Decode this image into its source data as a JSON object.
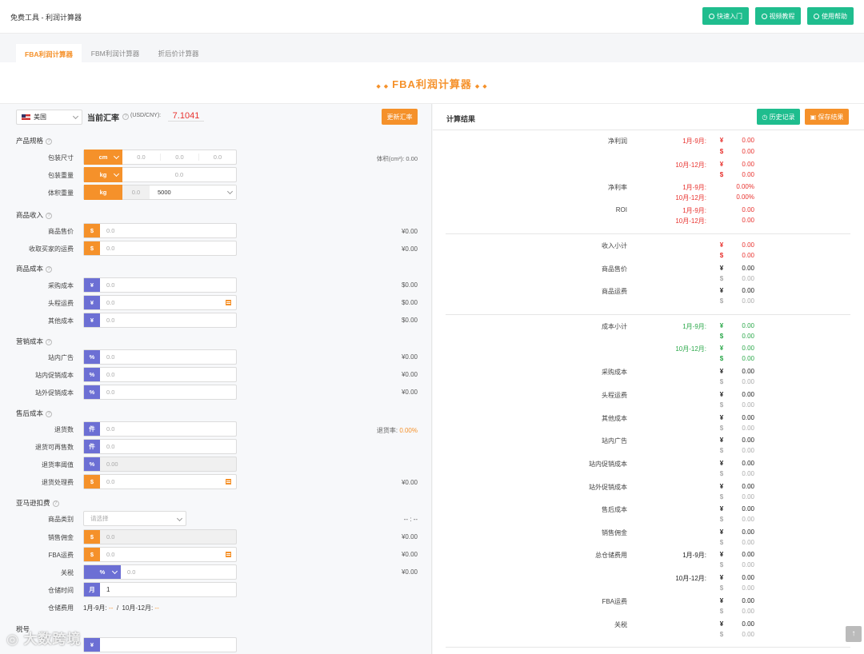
{
  "header": {
    "breadcrumb": "免费工具 - 利润计算器",
    "btn_quick": "快速入门",
    "btn_video": "视频教程",
    "btn_help": "使用帮助"
  },
  "tabs": [
    "FBA利润计算器",
    "FBM利润计算器",
    "折后价计算器"
  ],
  "banner": {
    "title": "FBA利润计算器"
  },
  "rate": {
    "country": "美国",
    "label": "当前汇率",
    "unit": "(USD/CNY):",
    "value": "7.1041",
    "update_btn": "更新汇率"
  },
  "spec": {
    "title": "产品规格",
    "size_label": "包装尺寸",
    "size_unit": "cm",
    "size_ph": [
      "0.0",
      "0.0",
      "0.0"
    ],
    "volume_text": "体积(cm³): 0.00",
    "weight_label": "包装重量",
    "weight_unit": "kg",
    "weight_ph": "0.0",
    "vol_weight_label": "体积重量",
    "vol_weight_unit": "kg",
    "vol_weight_val": "0.0",
    "divisor": "5000"
  },
  "income": {
    "title": "商品收入",
    "rows": [
      {
        "label": "商品售价",
        "pre": "$",
        "ph": "0.0",
        "val": "¥0.00"
      },
      {
        "label": "收取买家的运费",
        "pre": "$",
        "ph": "0.0",
        "val": "¥0.00"
      }
    ]
  },
  "cost": {
    "title": "商品成本",
    "rows": [
      {
        "label": "采购成本",
        "pre": "¥",
        "ph": "0.0",
        "val": "$0.00"
      },
      {
        "label": "头程运费",
        "pre": "¥",
        "ph": "0.0",
        "val": "$0.00"
      },
      {
        "label": "其他成本",
        "pre": "¥",
        "ph": "0.0",
        "val": "$0.00"
      }
    ]
  },
  "marketing": {
    "title": "营销成本",
    "rows": [
      {
        "label": "站内广告",
        "pre": "%",
        "ph": "0.0",
        "val": "¥0.00"
      },
      {
        "label": "站内促销成本",
        "pre": "%",
        "ph": "0.0",
        "val": "¥0.00"
      },
      {
        "label": "站外促销成本",
        "pre": "%",
        "ph": "0.0",
        "val": "¥0.00"
      }
    ]
  },
  "after": {
    "title": "售后成本",
    "rows": [
      {
        "label": "退货数",
        "pre": "件",
        "ph": "0.0"
      },
      {
        "label": "退货可再售数",
        "pre": "件",
        "ph": "0.0"
      },
      {
        "label": "退货率阈值",
        "pre": "%",
        "ph": "0.00"
      },
      {
        "label": "退货处理费",
        "pre": "$",
        "ph": "0.0",
        "val": "¥0.00"
      }
    ],
    "return_rate_label": "退货率:",
    "return_rate_val": "0.00%"
  },
  "amazon": {
    "title": "亚马逊扣费",
    "category_label": "商品类别",
    "category_ph": "请选择",
    "category_val": "-- : --",
    "commission_label": "销售佣金",
    "commission_ph": "0.0",
    "commission_val": "¥0.00",
    "fba_label": "FBA运费",
    "fba_ph": "0.0",
    "fba_val": "¥0.00",
    "tariff_label": "关税",
    "tariff_unit": "%",
    "tariff_ph": "0.0",
    "tariff_val": "¥0.00",
    "storage_time_label": "仓储时间",
    "storage_time_unit": "月",
    "storage_time_val": "1",
    "storage_fee_label": "仓储费用",
    "storage_fee_text1": "1月-9月:",
    "storage_fee_v1": "--",
    "storage_fee_sep": "/",
    "storage_fee_text2": "10月-12月:",
    "storage_fee_v2": "--"
  },
  "tax": {
    "title": "税号"
  },
  "results": {
    "title": "计算结果",
    "history_btn": "历史记录",
    "save_btn": "保存结果",
    "net_profit": {
      "label": "净利润",
      "p1": "1月-9月:",
      "p2": "10月-12月:",
      "v": [
        "0.00",
        "0.00",
        "0.00",
        "0.00"
      ]
    },
    "net_rate": {
      "label": "净利率",
      "p1": "1月-9月:",
      "p2": "10月-12月:",
      "v1": "0.00%",
      "v2": "0.00%"
    },
    "roi": {
      "label": "ROI",
      "p1": "1月-9月:",
      "p2": "10月-12月:",
      "v1": "0.00",
      "v2": "0.00"
    },
    "income_sub": {
      "label": "收入小计",
      "v": [
        "0.00",
        "0.00"
      ]
    },
    "income_items": [
      {
        "label": "商品售价",
        "v": [
          "0.00",
          "0.00"
        ]
      },
      {
        "label": "商品运费",
        "v": [
          "0.00",
          "0.00"
        ]
      }
    ],
    "cost_sub": {
      "label": "成本小计",
      "p1": "1月-9月:",
      "p2": "10月-12月:",
      "v": [
        "0.00",
        "0.00",
        "0.00",
        "0.00"
      ]
    },
    "cost_items": [
      {
        "label": "采购成本",
        "v": [
          "0.00",
          "0.00"
        ]
      },
      {
        "label": "头程运费",
        "v": [
          "0.00",
          "0.00"
        ]
      },
      {
        "label": "其他成本",
        "v": [
          "0.00",
          "0.00"
        ]
      },
      {
        "label": "站内广告",
        "v": [
          "0.00",
          "0.00"
        ]
      },
      {
        "label": "站内促销成本",
        "v": [
          "0.00",
          "0.00"
        ]
      },
      {
        "label": "站外促销成本",
        "v": [
          "0.00",
          "0.00"
        ]
      },
      {
        "label": "售后成本",
        "v": [
          "0.00",
          "0.00"
        ]
      },
      {
        "label": "销售佣金",
        "v": [
          "0.00",
          "0.00"
        ]
      }
    ],
    "storage": {
      "label": "总仓储费用",
      "p1": "1月-9月:",
      "p2": "10月-12月:",
      "v": [
        "0.00",
        "0.00",
        "0.00",
        "0.00"
      ]
    },
    "tail_items": [
      {
        "label": "FBA运费",
        "v": [
          "0.00",
          "0.00"
        ]
      },
      {
        "label": "关税",
        "v": [
          "0.00",
          "0.00"
        ]
      }
    ]
  },
  "currency": {
    "cny": "¥",
    "usd": "$"
  },
  "watermark": "大数跨境",
  "scroll_top": "↑"
}
